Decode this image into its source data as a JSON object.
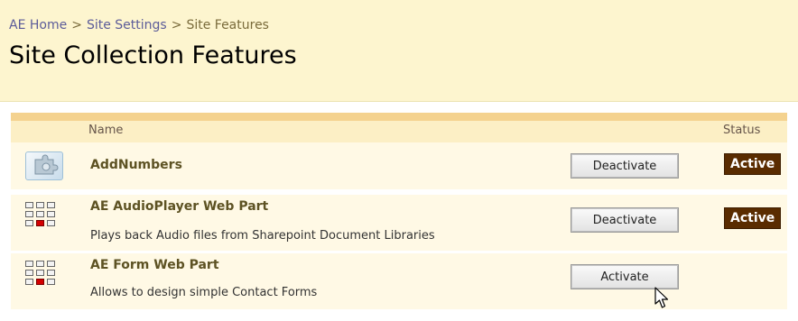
{
  "breadcrumb": {
    "items": [
      "AE Home",
      "Site Settings",
      "Site Features"
    ],
    "separator": ">"
  },
  "page_title": "Site Collection Features",
  "table": {
    "headers": {
      "name": "Name",
      "status": "Status"
    },
    "rows": [
      {
        "icon": "puzzle-gear-icon",
        "title": "AddNumbers",
        "description": "",
        "button": "Deactivate",
        "status": "Active"
      },
      {
        "icon": "webpart-grid-icon",
        "title": "AE AudioPlayer Web Part",
        "description": "Plays back Audio files from Sharepoint Document Libraries",
        "button": "Deactivate",
        "status": "Active"
      },
      {
        "icon": "webpart-grid-icon",
        "title": "AE Form Web Part",
        "description": "Allows to design simple Contact Forms",
        "button": "Activate",
        "status": ""
      }
    ]
  },
  "colors": {
    "header_bg": "#fdf5cf",
    "row_bg": "#fff9e5",
    "active_badge": "#5a2c00",
    "accent_bar": "#f4d28f"
  }
}
